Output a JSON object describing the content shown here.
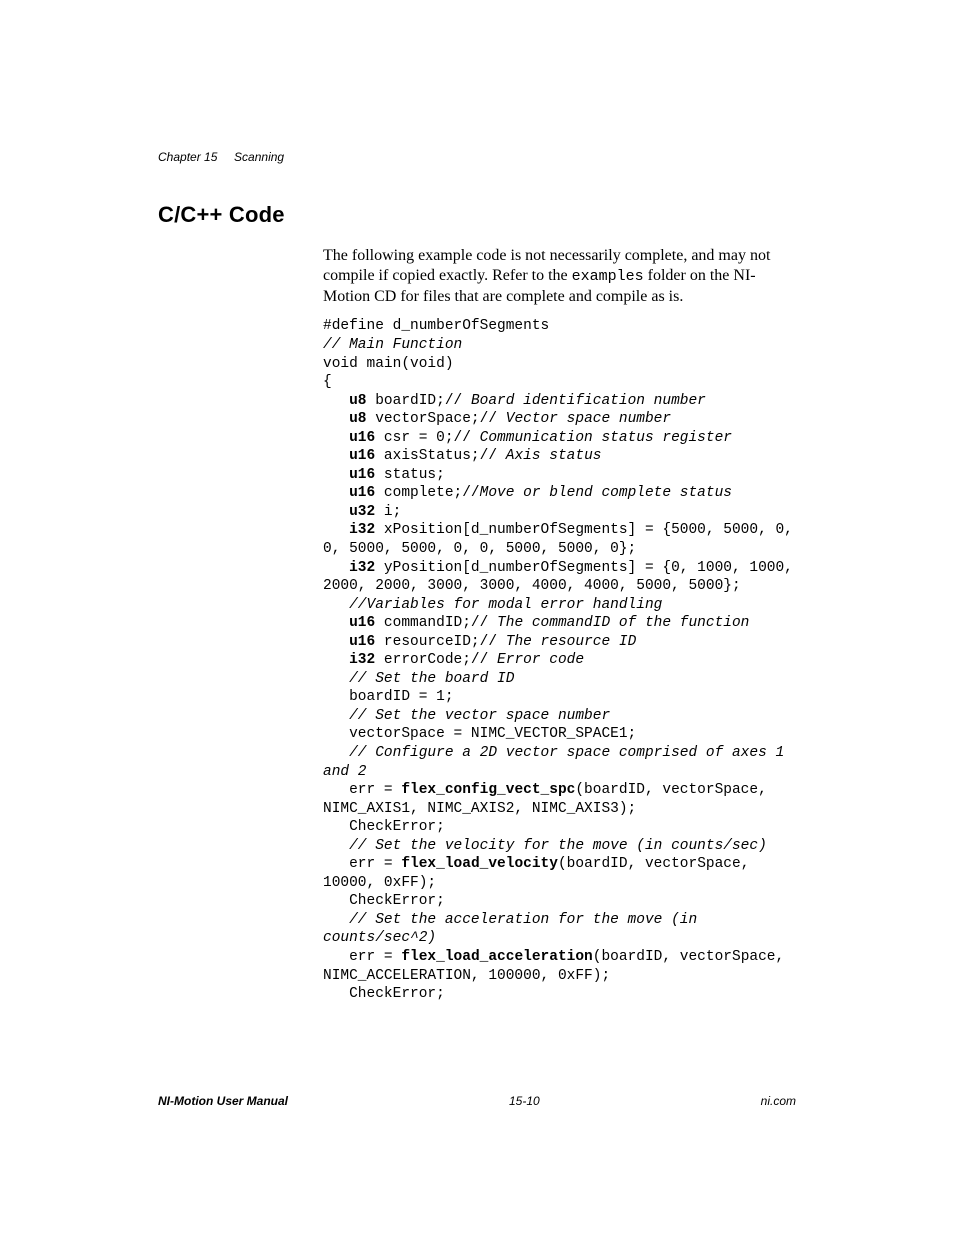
{
  "header": {
    "chapter_label": "Chapter 15",
    "chapter_title": "Scanning"
  },
  "section_title": "C/C++ Code",
  "intro": {
    "part1": "The following example code is not necessarily complete, and may not compile if copied exactly. Refer to the ",
    "mono": "examples",
    "part2": " folder on the NI-Motion CD for files that are complete and compile as is."
  },
  "code": {
    "l01": "#define d_numberOfSegments",
    "l02a": "// ",
    "l02b": "Main Function",
    "l03": "void main(void)",
    "l04": "{",
    "l05a": "u8",
    "l05b": " boardID;// ",
    "l05c": "Board identification number",
    "l06a": "u8",
    "l06b": " vectorSpace;// ",
    "l06c": "Vector space number",
    "l07a": "u16",
    "l07b": " csr = 0;// ",
    "l07c": "Communication status register",
    "l08a": "u16",
    "l08b": " axisStatus;// ",
    "l08c": "Axis status",
    "l09a": "u16",
    "l09b": " status;",
    "l10a": "u16",
    "l10b": " complete;//",
    "l10c": "Move or blend complete status",
    "l11a": "u32",
    "l11b": " i;",
    "l12a": "i32",
    "l12b": " xPosition[d_numberOfSegments] = {5000, 5000, 0, 0, 5000, 5000, 0, 0, 5000, 5000, 0};",
    "l13a": "i32",
    "l13b": " yPosition[d_numberOfSegments] = {0, 1000, 1000, 2000, 2000, 3000, 3000, 4000, 4000, 5000, 5000};",
    "l14": "//",
    "l14b": "Variables for modal error handling",
    "l15a": "u16",
    "l15b": " commandID;// ",
    "l15c": "The commandID of the function",
    "l16a": "u16",
    "l16b": " resourceID;// ",
    "l16c": "The resource ID",
    "l17a": "i32",
    "l17b": " errorCode;// ",
    "l17c": "Error code",
    "l18a": "// ",
    "l18b": "Set the board ID",
    "l19": "boardID = 1;",
    "l20a": "// ",
    "l20b": "Set the vector space number",
    "l21": "vectorSpace = NIMC_VECTOR_SPACE1;",
    "l22a": "// ",
    "l22b": "Configure a 2D vector space comprised of axes 1 and 2",
    "l23a": "err = ",
    "l23b": "flex_config_vect_spc",
    "l23c": "(boardID, vectorSpace, NIMC_AXIS1, NIMC_AXIS2, NIMC_AXIS3);",
    "l24": "CheckError;",
    "l25a": "// ",
    "l25b": "Set the velocity for the move (in counts/sec)",
    "l26a": "err = ",
    "l26b": "flex_load_velocity",
    "l26c": "(boardID, vectorSpace, 10000, 0xFF);",
    "l27": "CheckError;",
    "l28a": "// ",
    "l28b": "Set the acceleration for the move (in counts/sec^2)",
    "l29a": "err = ",
    "l29b": "flex_load_acceleration",
    "l29c": "(boardID, vectorSpace, NIMC_ACCELERATION, 100000, 0xFF);",
    "l30": "CheckError;"
  },
  "footer": {
    "left": "NI-Motion User Manual",
    "center": "15-10",
    "right": "ni.com"
  }
}
